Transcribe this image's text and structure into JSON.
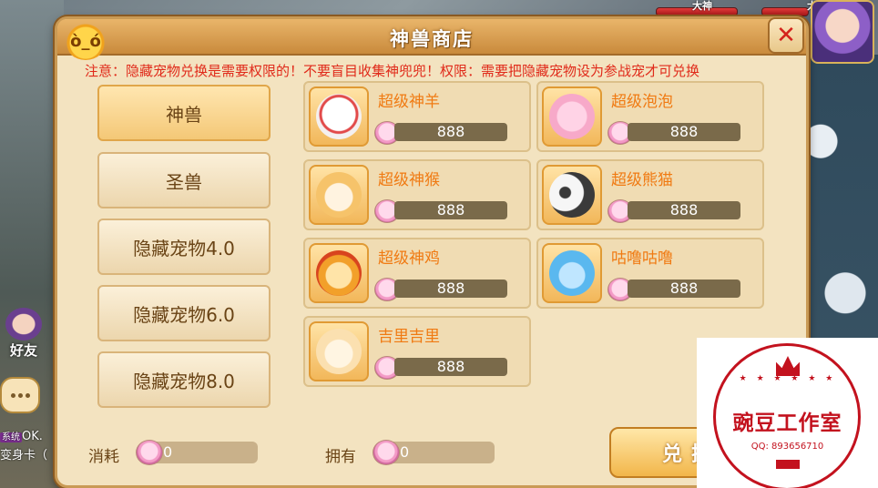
{
  "hud": {
    "player1_name": "大神",
    "player2_name": "大神"
  },
  "left": {
    "friend_label": "好友",
    "sys_tag": "系统",
    "sys_line1": "OK.",
    "sys_line2": "变身卡（"
  },
  "shop": {
    "title": "神兽商店",
    "notice": "注意：隐藏宠物兑换是需要权限的！不要盲目收集神兜兜！权限：需要把隐藏宠物设为参战宠才可兑换",
    "tabs": [
      {
        "label": "神兽"
      },
      {
        "label": "圣兽"
      },
      {
        "label": "隐藏宠物4.0"
      },
      {
        "label": "隐藏宠物6.0"
      },
      {
        "label": "隐藏宠物8.0"
      }
    ],
    "items": [
      {
        "name": "超级神羊",
        "price": "888",
        "color": "#f4f0f0"
      },
      {
        "name": "超级泡泡",
        "price": "888",
        "color": "#f7a9c9"
      },
      {
        "name": "超级神猴",
        "price": "888",
        "color": "#f6c36a"
      },
      {
        "name": "超级熊猫",
        "price": "888",
        "color": "#3a3a3a"
      },
      {
        "name": "超级神鸡",
        "price": "888",
        "color": "#f2a02a"
      },
      {
        "name": "咕噜咕噜",
        "price": "888",
        "color": "#5ab8ef"
      },
      {
        "name": "吉里吉里",
        "price": "888",
        "color": "#fbe0b0"
      }
    ],
    "cost_label": "消耗",
    "cost_value": "0",
    "own_label": "拥有",
    "own_value": "0",
    "exchange_label": "兑换"
  },
  "watermark": {
    "text": "豌豆工作室",
    "qq": "QQ: 893656710"
  }
}
